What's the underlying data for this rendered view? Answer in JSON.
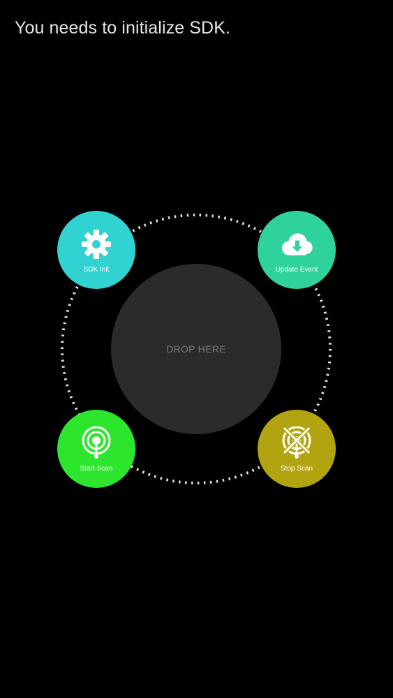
{
  "status": {
    "message": "You needs to initialize SDK."
  },
  "drop_zone": {
    "label": "DROP HERE"
  },
  "actions": {
    "sdk_init": {
      "label": "SDK Init",
      "color": "#31d2d2",
      "icon": "gear-icon"
    },
    "update_event": {
      "label": "Update Event",
      "color": "#2fd19d",
      "icon": "cloud-download-icon"
    },
    "start_scan": {
      "label": "Start Scan",
      "color": "#2ee52e",
      "icon": "broadcast-pin-icon"
    },
    "stop_scan": {
      "label": "Stop Scan",
      "color": "#b2a310",
      "icon": "broadcast-off-icon"
    }
  },
  "colors": {
    "background": "#000000",
    "drop_zone": "#2b2b2b",
    "ring_dots": "#e0e0e0"
  }
}
